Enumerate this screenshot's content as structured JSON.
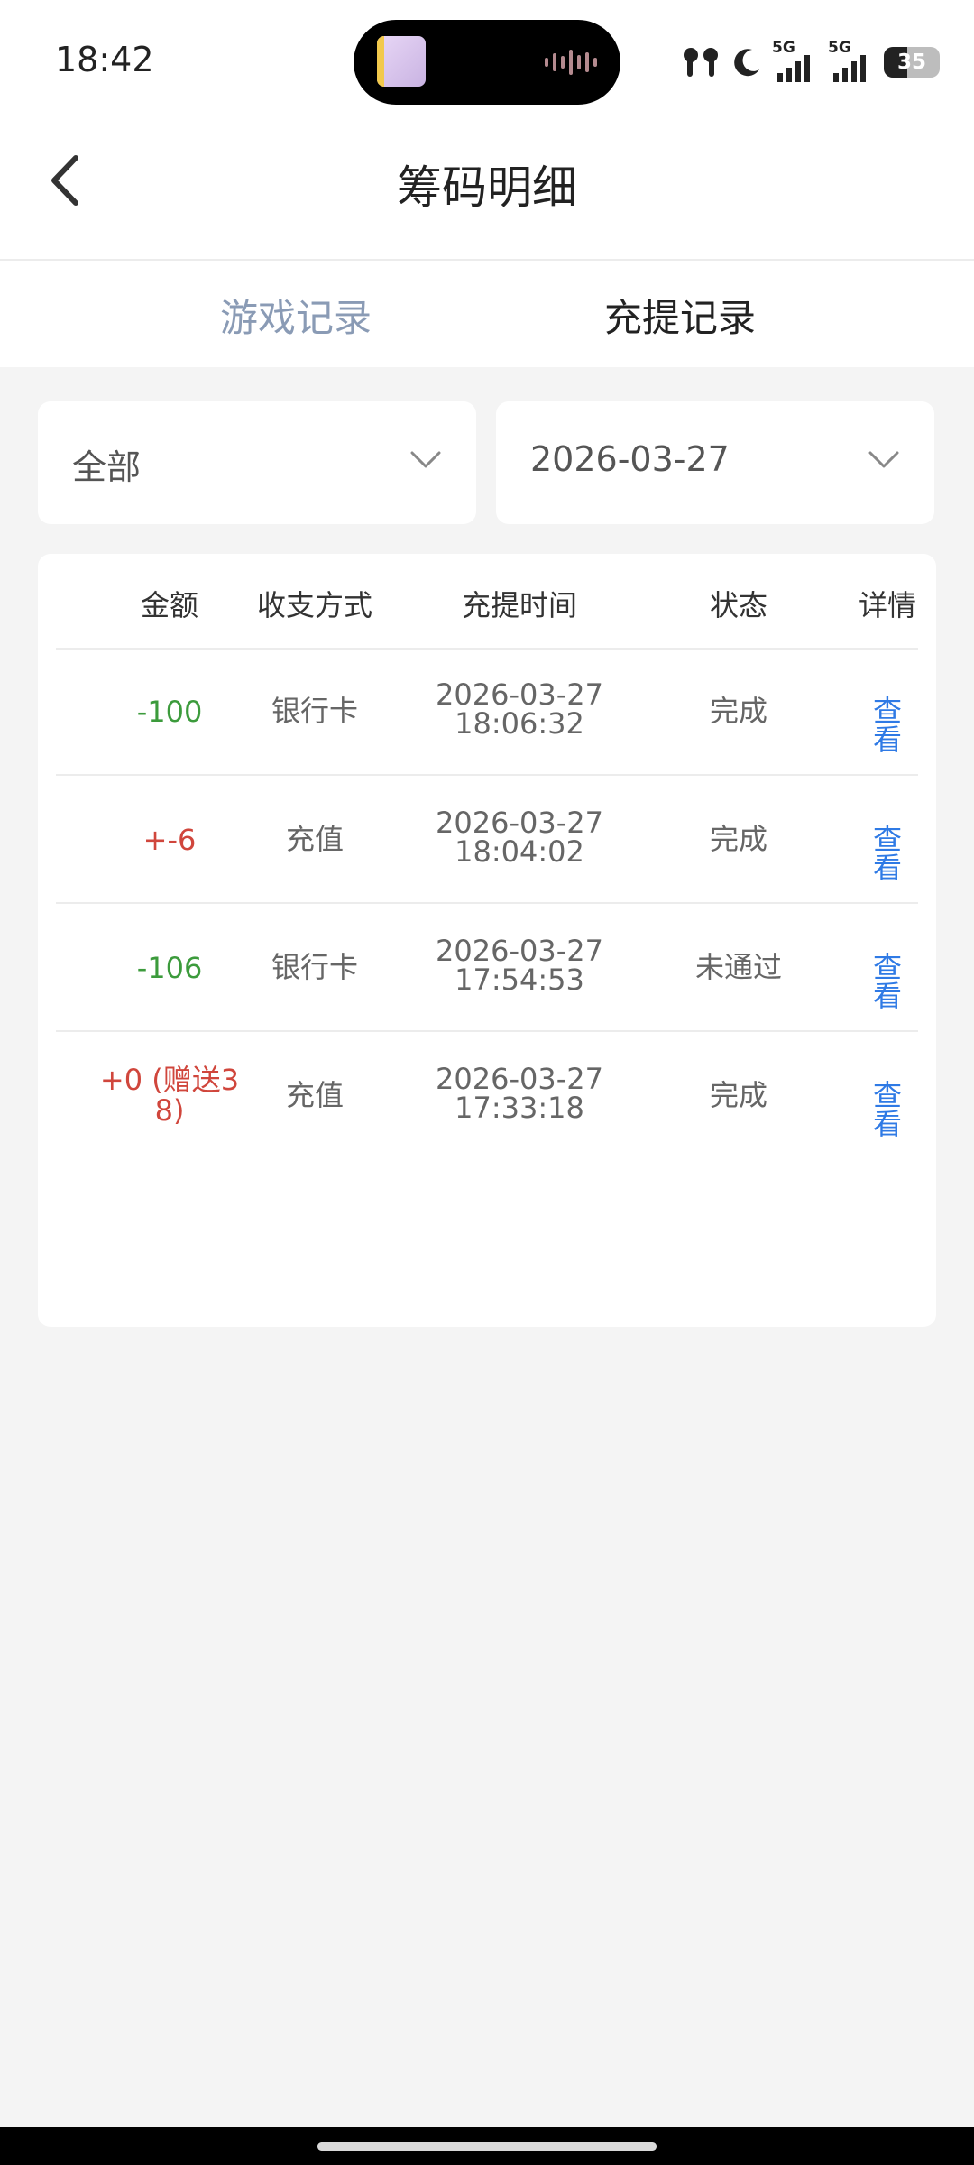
{
  "status_bar": {
    "time": "18:42",
    "battery": "35",
    "network_1": "5G",
    "network_2": "5G"
  },
  "header": {
    "title": "筹码明细"
  },
  "tabs": [
    {
      "label": "游戏记录",
      "active": false
    },
    {
      "label": "充提记录",
      "active": true
    }
  ],
  "filters": {
    "type": "全部",
    "date": "2026-03-27"
  },
  "table": {
    "columns": [
      "金额",
      "收支方式",
      "充提时间",
      "状态",
      "详情"
    ],
    "rows": [
      {
        "amount": "-100",
        "method": "银行卡",
        "date": "2026-03-27",
        "time": "18:06:32",
        "status": "完成",
        "detail": "查看",
        "amount_color": "green"
      },
      {
        "amount": "+-6",
        "method": "充值",
        "date": "2026-03-27",
        "time": "18:04:02",
        "status": "完成",
        "detail": "查看",
        "amount_color": "red"
      },
      {
        "amount": "-106",
        "method": "银行卡",
        "date": "2026-03-27",
        "time": "17:54:53",
        "status": "未通过",
        "detail": "查看",
        "amount_color": "green"
      },
      {
        "amount": "+0 (赠送3",
        "amount_line2": "8)",
        "method": "充值",
        "date": "2026-03-27",
        "time": "17:33:18",
        "status": "完成",
        "detail": "查看",
        "amount_color": "red"
      }
    ]
  },
  "colors": {
    "positive": "#d0463c",
    "negative": "#3c9b3c",
    "link": "#2f7ae5",
    "inactive_tab": "#8a9bb5"
  }
}
